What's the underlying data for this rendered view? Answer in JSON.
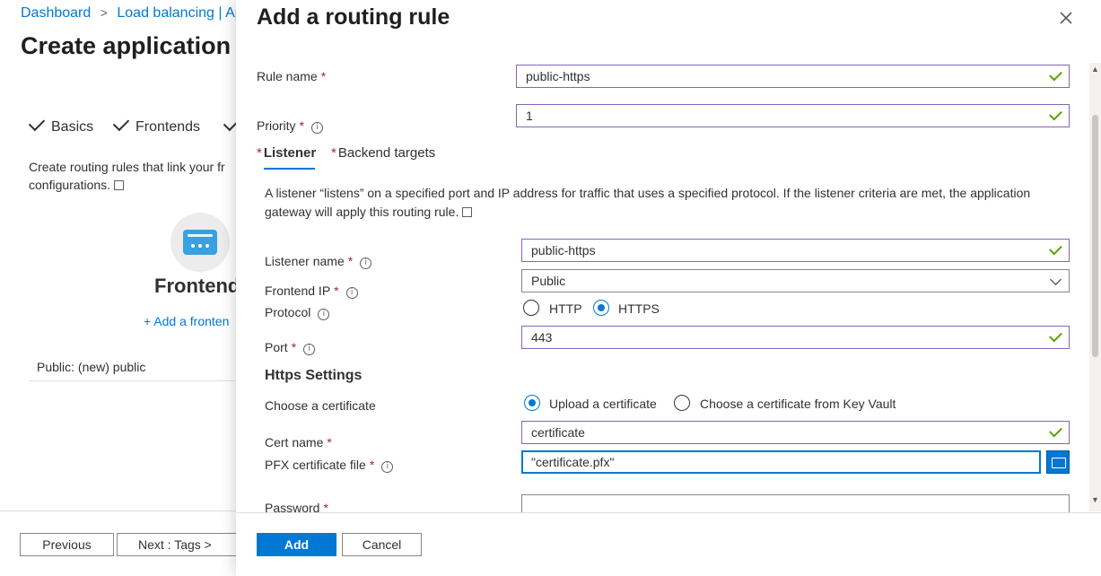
{
  "breadcrumb": {
    "dashboard": "Dashboard",
    "separator": ">",
    "current": "Load balancing | Ap"
  },
  "background_page": {
    "title": "Create application g",
    "steps": [
      "Basics",
      "Frontends"
    ],
    "description_line1": "Create routing rules that link your fr",
    "description_line2": "configurations.",
    "frontend_heading": "Frontend",
    "add_frontend": "+ Add a fronten",
    "frontend_item": "Public: (new) public",
    "buttons": {
      "previous": "Previous",
      "next": "Next : Tags >"
    }
  },
  "panel": {
    "title": "Add a routing rule",
    "close_icon": "close-icon",
    "rule_name": {
      "label": "Rule name",
      "value": "public-https"
    },
    "priority": {
      "label": "Priority",
      "value": "1"
    },
    "tabs": [
      {
        "label": "Listener",
        "required": "*"
      },
      {
        "label": "Backend targets",
        "required": "*"
      }
    ],
    "listener_description": "A listener “listens” on a specified port and IP address for traffic that uses a specified protocol. If the listener criteria are met, the application gateway will apply this routing rule.",
    "listener_name": {
      "label": "Listener name",
      "value": "public-https"
    },
    "frontend_ip": {
      "label": "Frontend IP",
      "value": "Public"
    },
    "protocol": {
      "label": "Protocol",
      "options": [
        "HTTP",
        "HTTPS"
      ],
      "selected": "HTTPS"
    },
    "port": {
      "label": "Port",
      "value": "443"
    },
    "https_settings": {
      "heading": "Https Settings",
      "choose_cert": {
        "label": "Choose a certificate",
        "options": [
          "Upload a certificate",
          "Choose a certificate from Key Vault"
        ],
        "selected": "Upload a certificate"
      },
      "cert_name": {
        "label": "Cert name",
        "value": "certificate"
      },
      "pfx_file": {
        "label": "PFX certificate file",
        "value": "\"certificate.pfx\""
      },
      "password": {
        "label": "Password",
        "value": ""
      }
    },
    "required_marker": "*",
    "info_glyph": "i",
    "footer": {
      "add": "Add",
      "cancel": "Cancel"
    }
  },
  "colors": {
    "accent": "#0078d4",
    "valid_border": "#8764b8",
    "valid_check": "#57a300",
    "required": "#a4262c"
  }
}
